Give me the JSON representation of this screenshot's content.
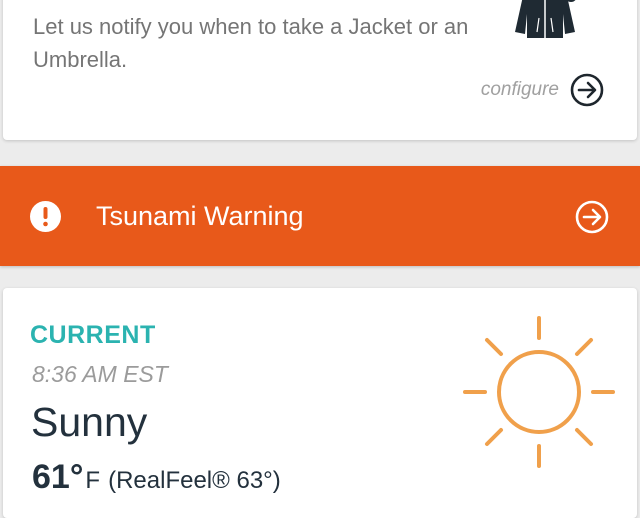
{
  "notify_card": {
    "message": "Let us notify you when to take a Jacket or an Umbrella.",
    "configure_label": "configure",
    "icons": [
      "jacket-icon",
      "arrow-circle-right-icon"
    ]
  },
  "warning": {
    "text": "Tsunami Warning",
    "icons": [
      "alert-circle-icon",
      "arrow-circle-right-icon"
    ],
    "color": "#e8591a"
  },
  "current": {
    "heading": "CURRENT",
    "time": "8:36 AM EST",
    "condition": "Sunny",
    "temperature": "61°",
    "unit": "F",
    "realfeel": "(RealFeel® 63°)",
    "icon": "sun-icon",
    "heading_color": "#2bb3b0",
    "sun_color": "#f0a04b"
  }
}
